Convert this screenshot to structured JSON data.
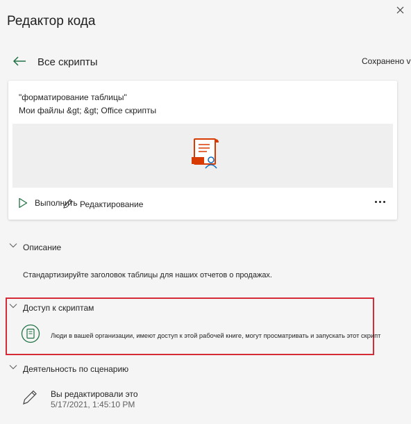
{
  "header": {
    "title": "Редактор кода",
    "back_label": "Все скрипты",
    "saved_status": "Сохранено v'"
  },
  "script_card": {
    "name": "\"форматирование таблицы\"",
    "path": "Мои файлы &gt; &gt; Office скрипты",
    "run_label": "Выполнить",
    "edit_label": "Редактирование"
  },
  "description": {
    "label": "Описание",
    "text": "Стандартизируйте заголовок таблицы для наших отчетов о продажах."
  },
  "access": {
    "label": "Доступ к скриптам",
    "text": "Люди в вашей организации, имеют доступ к этой рабочей книге, могут просматривать и запускать этот скрипт"
  },
  "activity": {
    "label": "Деятельность по сценарию",
    "items": [
      {
        "title": "Вы редактировали это",
        "time": "5/17/2021, 1:45:10 PM"
      }
    ]
  },
  "colors": {
    "accent_green": "#217346",
    "office_red": "#d83b01",
    "highlight_border": "#d42b37"
  }
}
